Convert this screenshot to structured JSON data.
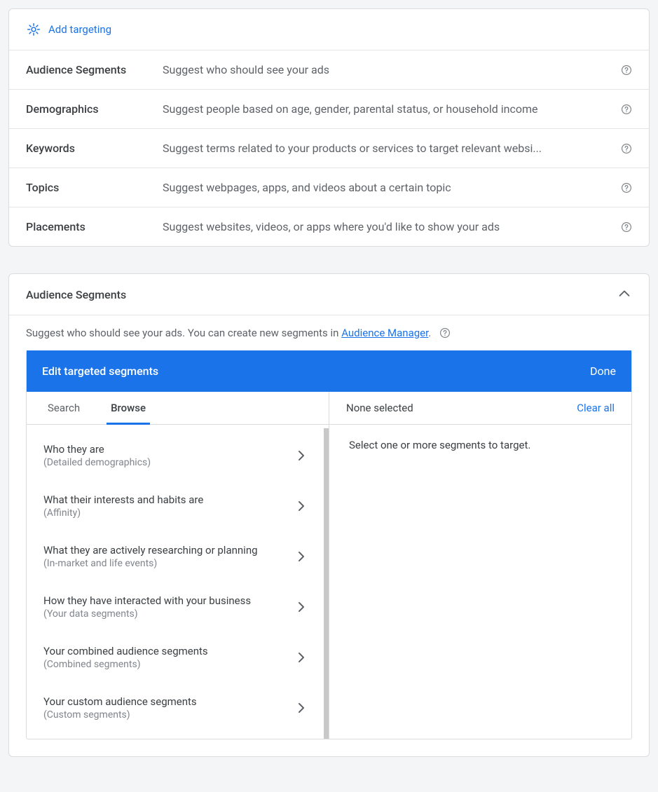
{
  "top": {
    "add_targeting": "Add targeting",
    "rows": [
      {
        "label": "Audience Segments",
        "desc": "Suggest who should see your ads"
      },
      {
        "label": "Demographics",
        "desc": "Suggest people based on age, gender, parental status, or household income"
      },
      {
        "label": "Keywords",
        "desc": "Suggest terms related to your products or services to target relevant websi..."
      },
      {
        "label": "Topics",
        "desc": "Suggest webpages, apps, and videos about a certain topic"
      },
      {
        "label": "Placements",
        "desc": "Suggest websites, videos, or apps where you'd like to show your ads"
      }
    ]
  },
  "aud": {
    "title": "Audience Segments",
    "sub_pre": "Suggest who should see your ads.  You can create new segments in ",
    "sub_link": "Audience Manager",
    "sub_post": ".",
    "bar_title": "Edit targeted segments",
    "bar_done": "Done",
    "tabs": {
      "search": "Search",
      "browse": "Browse"
    },
    "browse": [
      {
        "t1": "Who they are",
        "t2": "(Detailed demographics)"
      },
      {
        "t1": "What their interests and habits are",
        "t2": "(Affinity)"
      },
      {
        "t1": "What they are actively researching or planning",
        "t2": "(In-market and life events)"
      },
      {
        "t1": "How they have interacted with your business",
        "t2": "(Your data segments)"
      },
      {
        "t1": "Your combined audience segments",
        "t2": "(Combined segments)"
      },
      {
        "t1": "Your custom audience segments",
        "t2": "(Custom segments)"
      }
    ],
    "selected_header": "None selected",
    "clear_all": "Clear all",
    "selected_body": "Select one or more segments to target."
  }
}
